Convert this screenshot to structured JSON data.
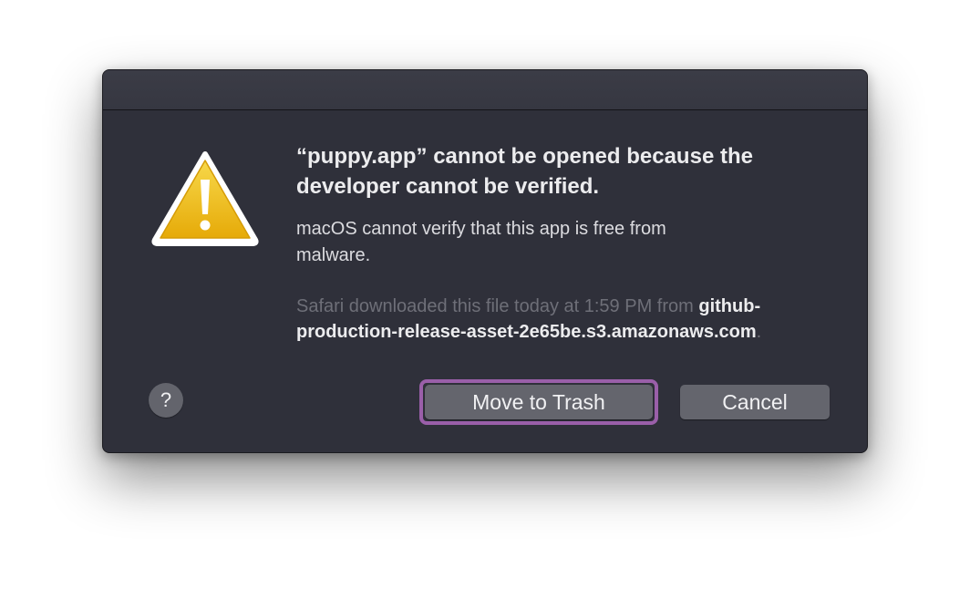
{
  "dialog": {
    "headline": "“puppy.app” cannot be opened because the developer cannot be verified.",
    "message": "macOS cannot verify that this app is free from malware.",
    "source_prefix": "Safari downloaded this file today at 1:59 PM from",
    "source_host": "github-production-release-asset-2e65be.s3.amazonaws.com",
    "source_suffix": ".",
    "icon": "warning-triangle-icon"
  },
  "buttons": {
    "help_label": "?",
    "move_to_trash_label": "Move to Trash",
    "cancel_label": "Cancel"
  },
  "colors": {
    "dialog_background": "#2f303a",
    "focus_ring": "#9a5fa9",
    "warning_fill": "#f0c21c"
  }
}
